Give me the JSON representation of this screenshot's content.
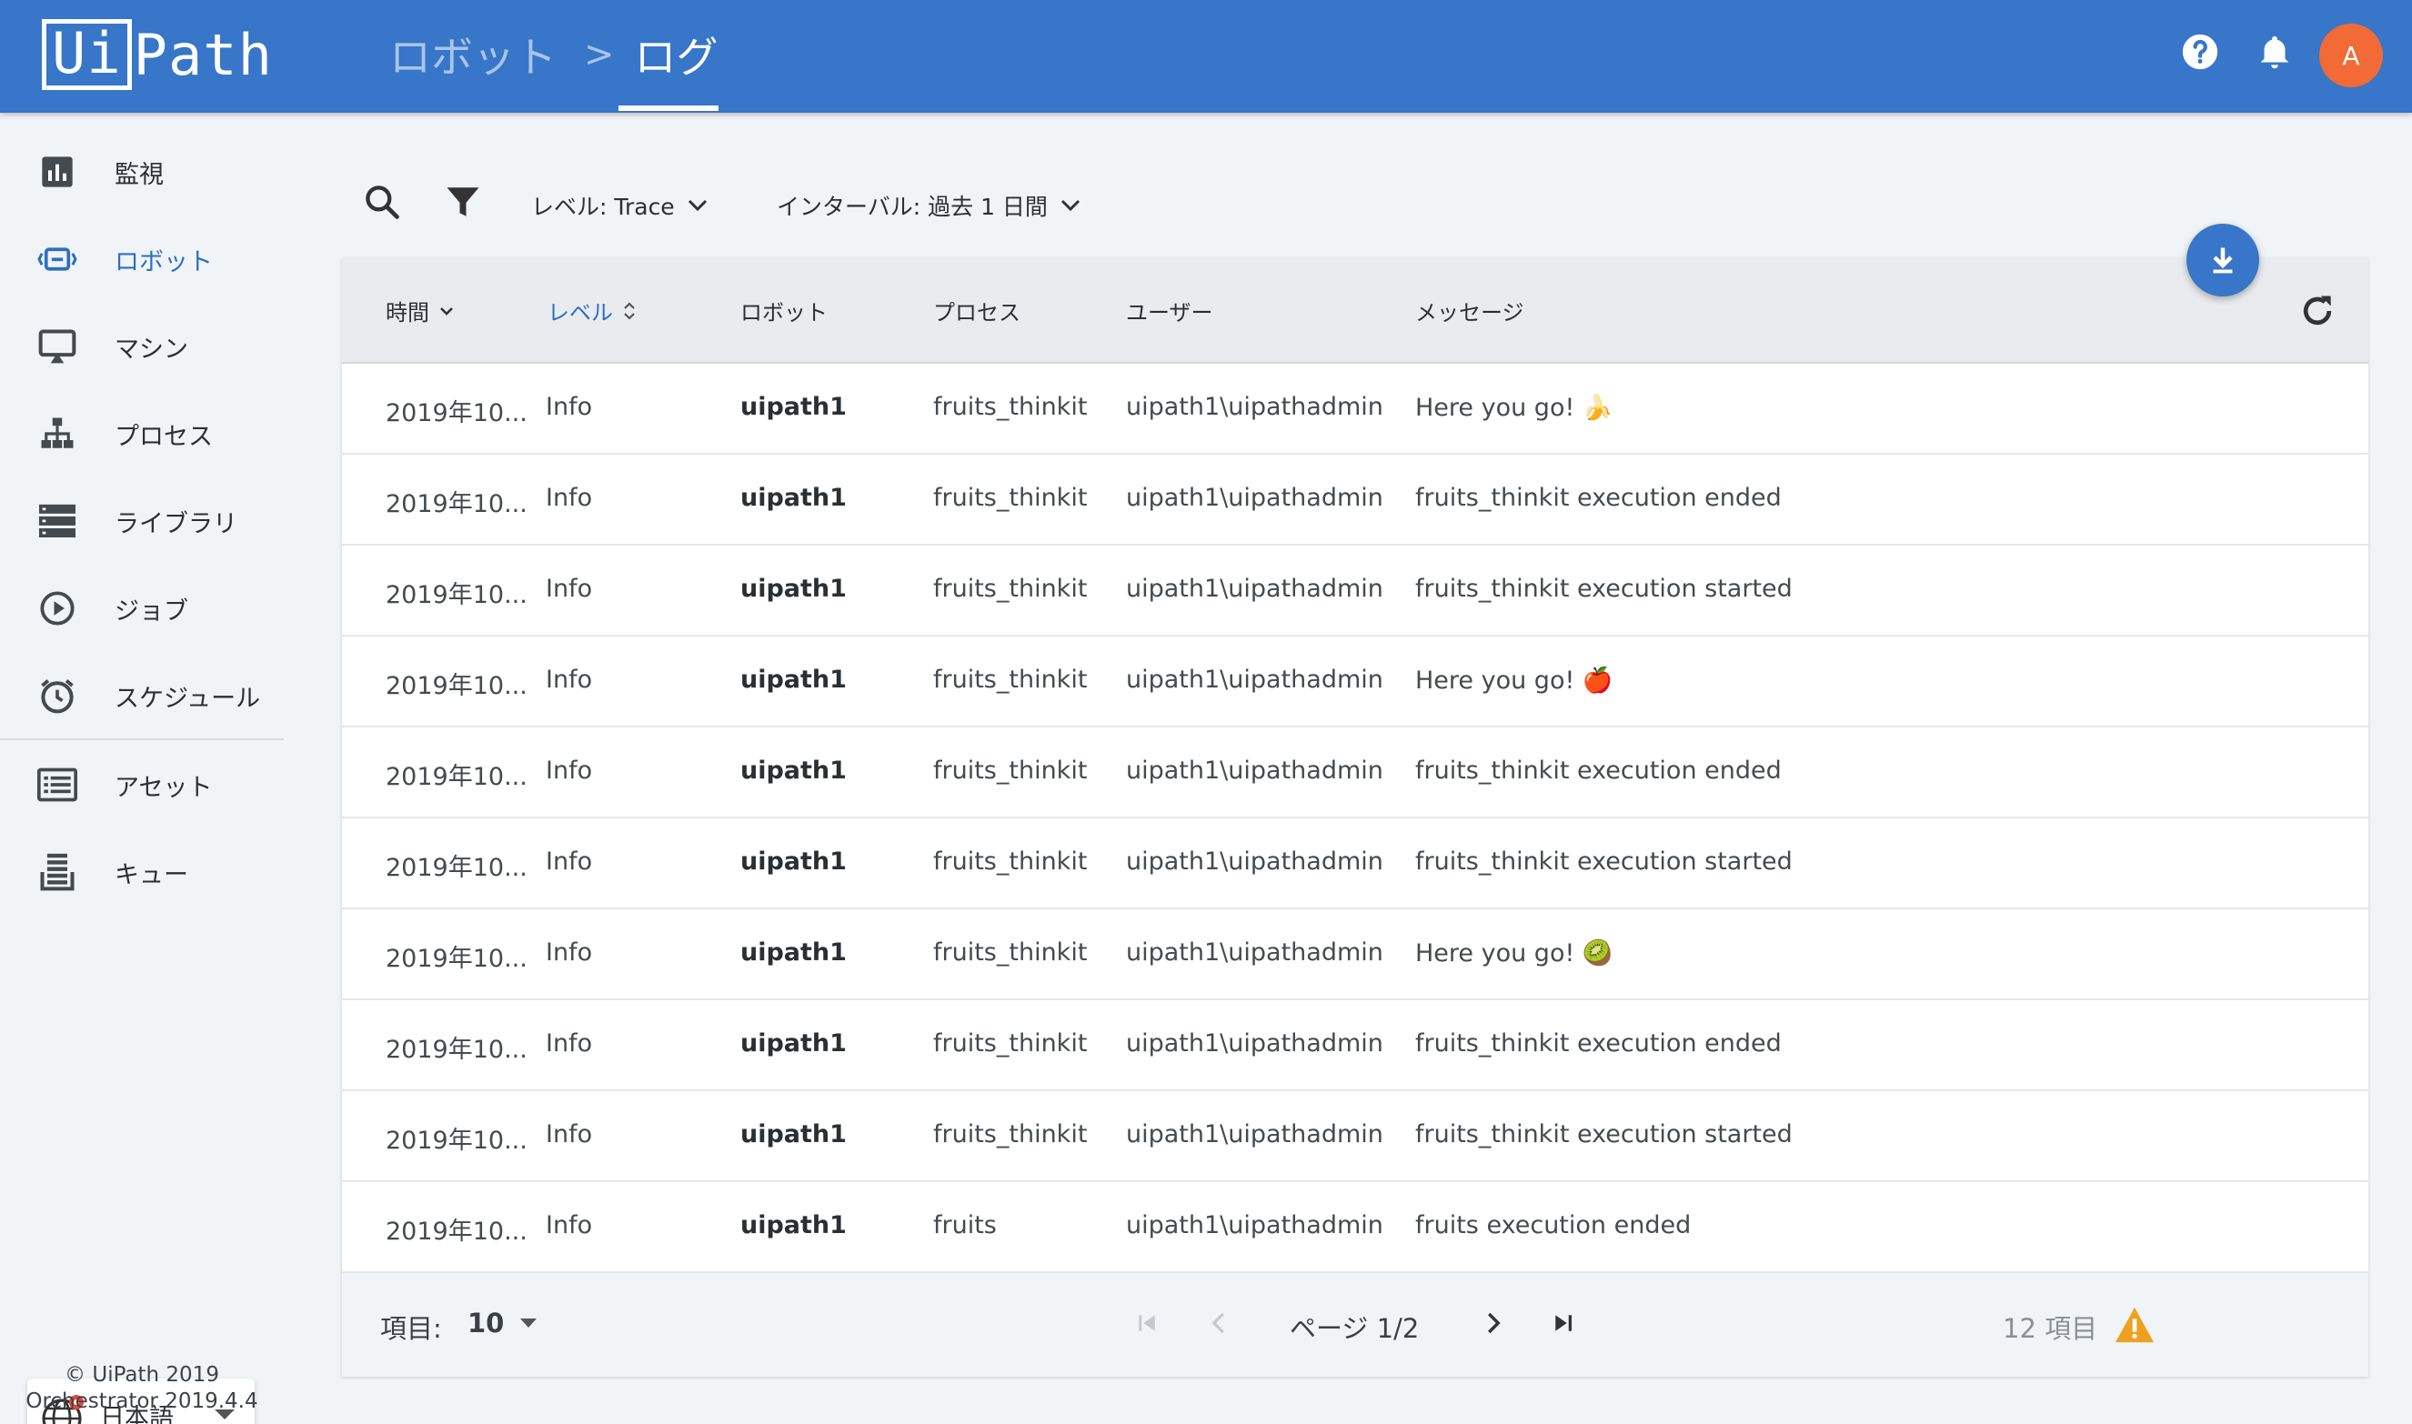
{
  "header": {
    "logo": "UiPath",
    "breadcrumb_parent": "ロボット",
    "breadcrumb_separator": ">",
    "breadcrumb_current": "ログ",
    "avatar_initial": "A",
    "icons": [
      "help-icon",
      "bell-icon"
    ]
  },
  "sidebar": {
    "items": [
      {
        "label": "監視",
        "icon": "chart-icon"
      },
      {
        "label": "ロボット",
        "icon": "robot-icon",
        "active": true
      },
      {
        "label": "マシン",
        "icon": "monitor-icon"
      },
      {
        "label": "プロセス",
        "icon": "hierarchy-icon"
      },
      {
        "label": "ライブラリ",
        "icon": "library-icon"
      },
      {
        "label": "ジョブ",
        "icon": "play-circle-icon"
      },
      {
        "label": "スケジュール",
        "icon": "alarm-icon"
      },
      {
        "label": "アセット",
        "icon": "asset-icon"
      },
      {
        "label": "キュー",
        "icon": "queue-icon"
      }
    ],
    "language": "日本語",
    "copyright": "© UiPath 2019",
    "version": "Orchestrator 2019.4.4"
  },
  "toolbar": {
    "level_filter": "レベル: Trace",
    "interval_filter": "インターバル: 過去 1 日間"
  },
  "table": {
    "columns": [
      "時間",
      "レベル",
      "ロボット",
      "プロセス",
      "ユーザー",
      "メッセージ"
    ],
    "rows": [
      {
        "time": "2019年10...",
        "level": "Info",
        "robot": "uipath1",
        "process": "fruits_thinkit",
        "user": "uipath1\\uipathadmin",
        "message": "Here you go! 🍌"
      },
      {
        "time": "2019年10...",
        "level": "Info",
        "robot": "uipath1",
        "process": "fruits_thinkit",
        "user": "uipath1\\uipathadmin",
        "message": "fruits_thinkit execution ended"
      },
      {
        "time": "2019年10...",
        "level": "Info",
        "robot": "uipath1",
        "process": "fruits_thinkit",
        "user": "uipath1\\uipathadmin",
        "message": "fruits_thinkit execution started"
      },
      {
        "time": "2019年10...",
        "level": "Info",
        "robot": "uipath1",
        "process": "fruits_thinkit",
        "user": "uipath1\\uipathadmin",
        "message": "Here you go! 🍎"
      },
      {
        "time": "2019年10...",
        "level": "Info",
        "robot": "uipath1",
        "process": "fruits_thinkit",
        "user": "uipath1\\uipathadmin",
        "message": "fruits_thinkit execution ended"
      },
      {
        "time": "2019年10...",
        "level": "Info",
        "robot": "uipath1",
        "process": "fruits_thinkit",
        "user": "uipath1\\uipathadmin",
        "message": "fruits_thinkit execution started"
      },
      {
        "time": "2019年10...",
        "level": "Info",
        "robot": "uipath1",
        "process": "fruits_thinkit",
        "user": "uipath1\\uipathadmin",
        "message": "Here you go! 🥝"
      },
      {
        "time": "2019年10...",
        "level": "Info",
        "robot": "uipath1",
        "process": "fruits_thinkit",
        "user": "uipath1\\uipathadmin",
        "message": "fruits_thinkit execution ended"
      },
      {
        "time": "2019年10...",
        "level": "Info",
        "robot": "uipath1",
        "process": "fruits_thinkit",
        "user": "uipath1\\uipathadmin",
        "message": "fruits_thinkit execution started"
      },
      {
        "time": "2019年10...",
        "level": "Info",
        "robot": "uipath1",
        "process": "fruits",
        "user": "uipath1\\uipathadmin",
        "message": "fruits execution ended"
      }
    ]
  },
  "footer": {
    "page_size_label": "項目:",
    "page_size": "10",
    "page_indicator": "ページ 1/2",
    "total_items": "12 項目"
  },
  "colors": {
    "header_bg": "#3776c8",
    "accent": "#2d6ec2",
    "avatar": "#f26a36",
    "warning": "#f0a020"
  }
}
